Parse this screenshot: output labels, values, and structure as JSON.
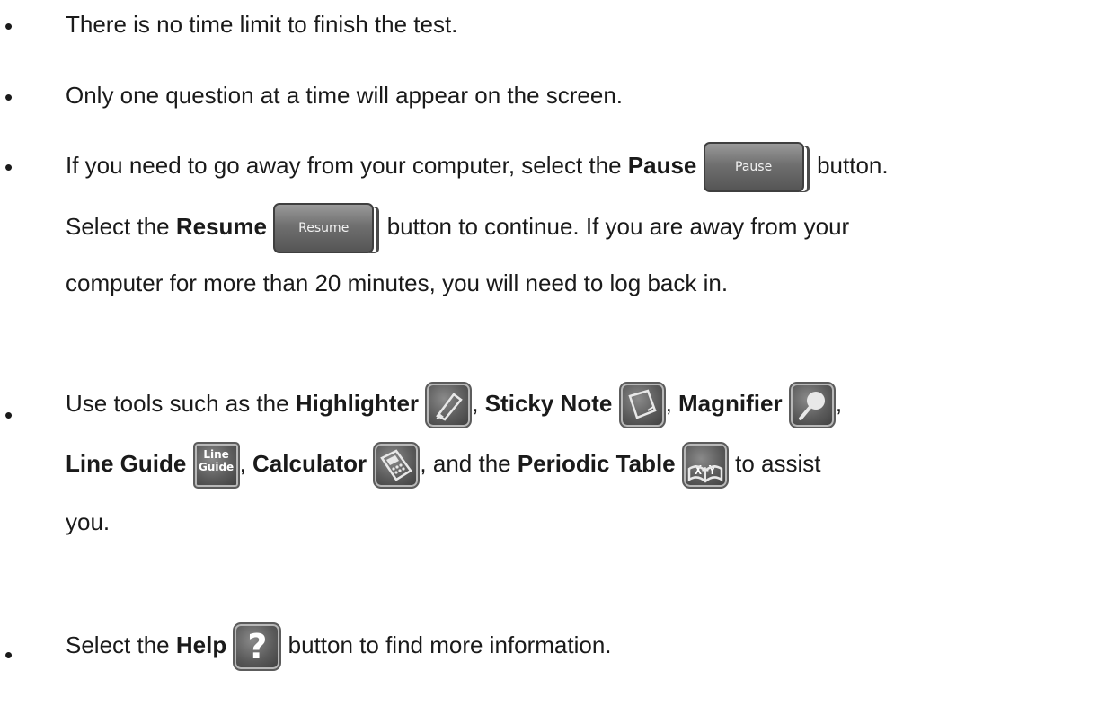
{
  "bullets": {
    "symbol": "•",
    "item1": {
      "text": "There is no time limit to finish the test."
    },
    "item2": {
      "text": "Only one question at a time will appear on the screen."
    },
    "item3": {
      "pre": "If you need to go away from your computer, select the ",
      "pause_bold": "Pause",
      "pause_button_label": "Pause",
      "post_pause": " button.",
      "line2_pre": "Select the ",
      "resume_bold": "Resume",
      "resume_button_label": "Resume",
      "line2_post": " button to continue. If you are away from your",
      "line3": "computer for more than 20 minutes, you will need to log back in."
    },
    "item4": {
      "pre": "Use tools such as the ",
      "highlighter": "Highlighter",
      "comma1": ", ",
      "sticky": "Sticky Note",
      "comma2": ", ",
      "magnifier": "Magnifier",
      "comma3": ",",
      "line_guide": "Line Guide",
      "line_guide_icon_top": "Line",
      "line_guide_icon_bottom": "Guide",
      "comma4": ", ",
      "calculator": "Calculator",
      "comma5": ", and the ",
      "periodic": "Periodic Table",
      "periodic_icon_text": "X+Y",
      "post": " to assist",
      "line3": "you."
    },
    "item5": {
      "pre": "Select the ",
      "help_bold": "Help",
      "help_icon_text": "?",
      "post": " button to find more information."
    }
  },
  "icons": [
    "highlighter-icon",
    "sticky-note-icon",
    "magnifier-icon",
    "line-guide-icon",
    "calculator-icon",
    "periodic-table-icon",
    "help-icon"
  ]
}
